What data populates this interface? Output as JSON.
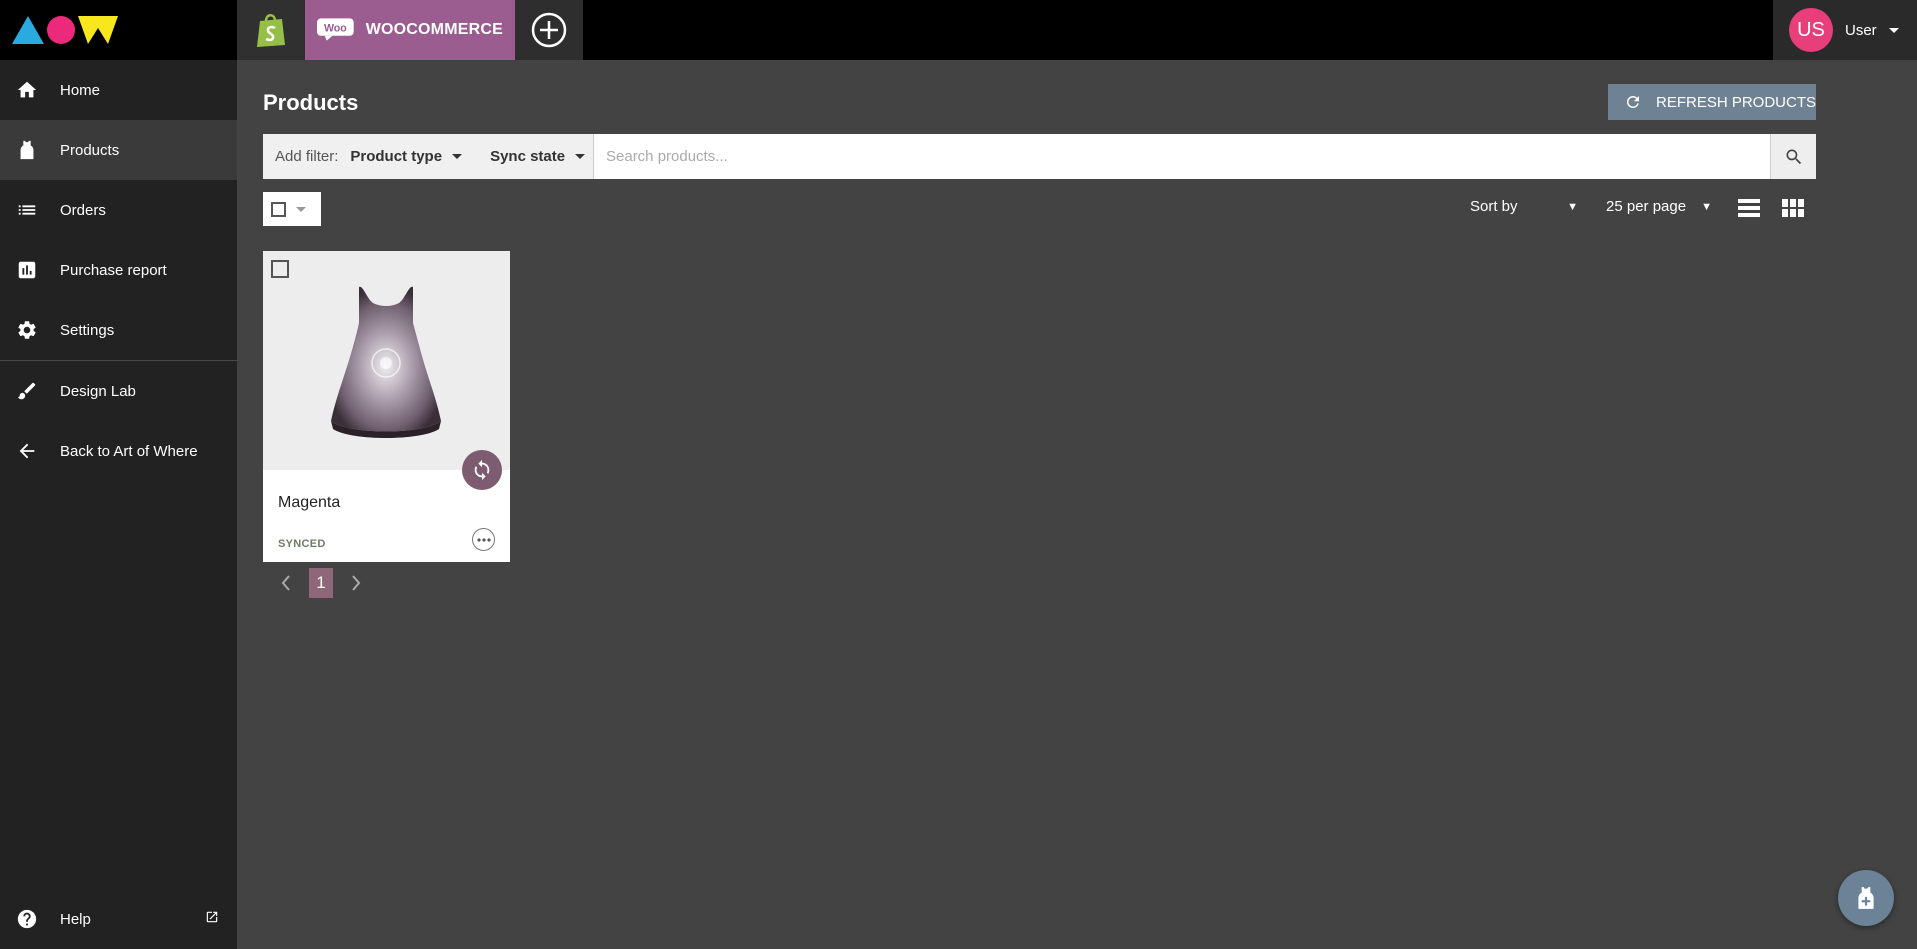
{
  "brand": {
    "logo": "aow-logo"
  },
  "stores": {
    "shopify_icon": "shopify-bag-icon",
    "woocommerce_label": "WOOCOMMERCE",
    "woocommerce_icon": "woo-logo-icon",
    "woocommerce_icon_text": "Woo",
    "add_icon": "plus-circle-icon"
  },
  "user": {
    "initials": "US",
    "name": "User"
  },
  "sidebar": {
    "items": [
      {
        "label": "Home",
        "icon": "home-icon"
      },
      {
        "label": "Products",
        "icon": "product-icon",
        "active": true
      },
      {
        "label": "Orders",
        "icon": "list-icon"
      },
      {
        "label": "Purchase report",
        "icon": "bar-chart-icon"
      },
      {
        "label": "Settings",
        "icon": "gear-icon"
      },
      {
        "label": "Design Lab",
        "icon": "brush-icon"
      },
      {
        "label": "Back to Art of Where",
        "icon": "arrow-left-icon"
      }
    ],
    "help_label": "Help"
  },
  "main": {
    "title": "Products",
    "refresh_label": "REFRESH PRODUCTS",
    "filters": {
      "label": "Add filter:",
      "product_type": "Product type",
      "sync_state": "Sync state",
      "search_placeholder": "Search products..."
    },
    "sort_label": "Sort by",
    "per_page_label": "25 per page",
    "products": [
      {
        "name": "Magenta",
        "status": "SYNCED"
      }
    ],
    "pagination": {
      "current_page": "1"
    }
  },
  "colors": {
    "woocommerce": "#9b5c8f",
    "sidebar_bg": "#222222",
    "main_bg": "#434343",
    "refresh_btn": "#6f8294",
    "active_page": "#8e6878",
    "avatar": "#e83e7a",
    "synced_text": "#6b7d63"
  }
}
